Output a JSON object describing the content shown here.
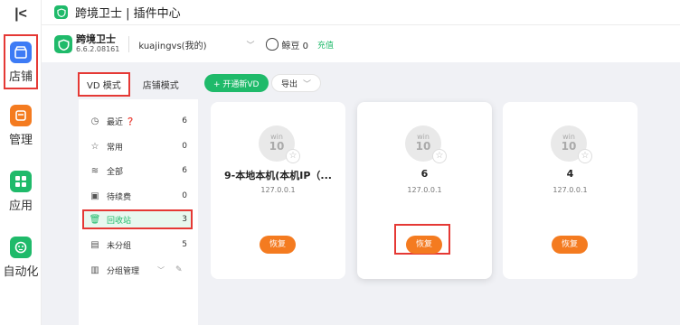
{
  "window": {
    "title": "跨境卫士 | 插件中心"
  },
  "rail": {
    "collapse_icon": "collapse-left-icon",
    "items": [
      {
        "label": "店铺",
        "icon": "store-icon",
        "color": "#3d7bf5",
        "active": true
      },
      {
        "label": "管理",
        "icon": "manage-icon",
        "color": "#f47b20"
      },
      {
        "label": "应用",
        "icon": "apps-icon",
        "color": "#1fba6a"
      },
      {
        "label": "自动化",
        "icon": "robot-icon",
        "color": "#1fba6a"
      }
    ]
  },
  "header": {
    "app_name": "跨境卫士",
    "version": "6.6.2.08161",
    "account": "kuajingvs(我的)",
    "beans_label": "鲸豆 0",
    "recharge_label": "充值"
  },
  "modes": {
    "vd": "VD 模式",
    "store": "店铺模式"
  },
  "toolbar": {
    "new_vd": "+ 开通新VD",
    "export": "导出"
  },
  "filters": [
    {
      "label": "最近",
      "count": "6",
      "icon": "clock-icon"
    },
    {
      "label": "常用",
      "count": "0",
      "icon": "star-icon"
    },
    {
      "label": "全部",
      "count": "6",
      "icon": "layers-icon"
    },
    {
      "label": "待续费",
      "count": "0",
      "icon": "renew-icon"
    },
    {
      "label": "回收站",
      "count": "3",
      "icon": "trash-icon",
      "selected": true
    },
    {
      "label": "未分组",
      "count": "5",
      "icon": "folder-icon"
    },
    {
      "label": "分组管理",
      "count": "",
      "icon": "group-icon"
    }
  ],
  "cards": [
    {
      "os_top": "win",
      "os_num": "10",
      "name": "9-本地本机(本机IP（...",
      "ip": "127.0.0.1",
      "action": "恢复"
    },
    {
      "os_top": "win",
      "os_num": "10",
      "name": "6",
      "ip": "127.0.0.1",
      "action": "恢复"
    },
    {
      "os_top": "win",
      "os_num": "10",
      "name": "4",
      "ip": "127.0.0.1",
      "action": "恢复"
    }
  ],
  "colors": {
    "green": "#1fba6a",
    "orange": "#f47b20",
    "blue": "#3d7bf5",
    "highlight": "#e53935"
  }
}
